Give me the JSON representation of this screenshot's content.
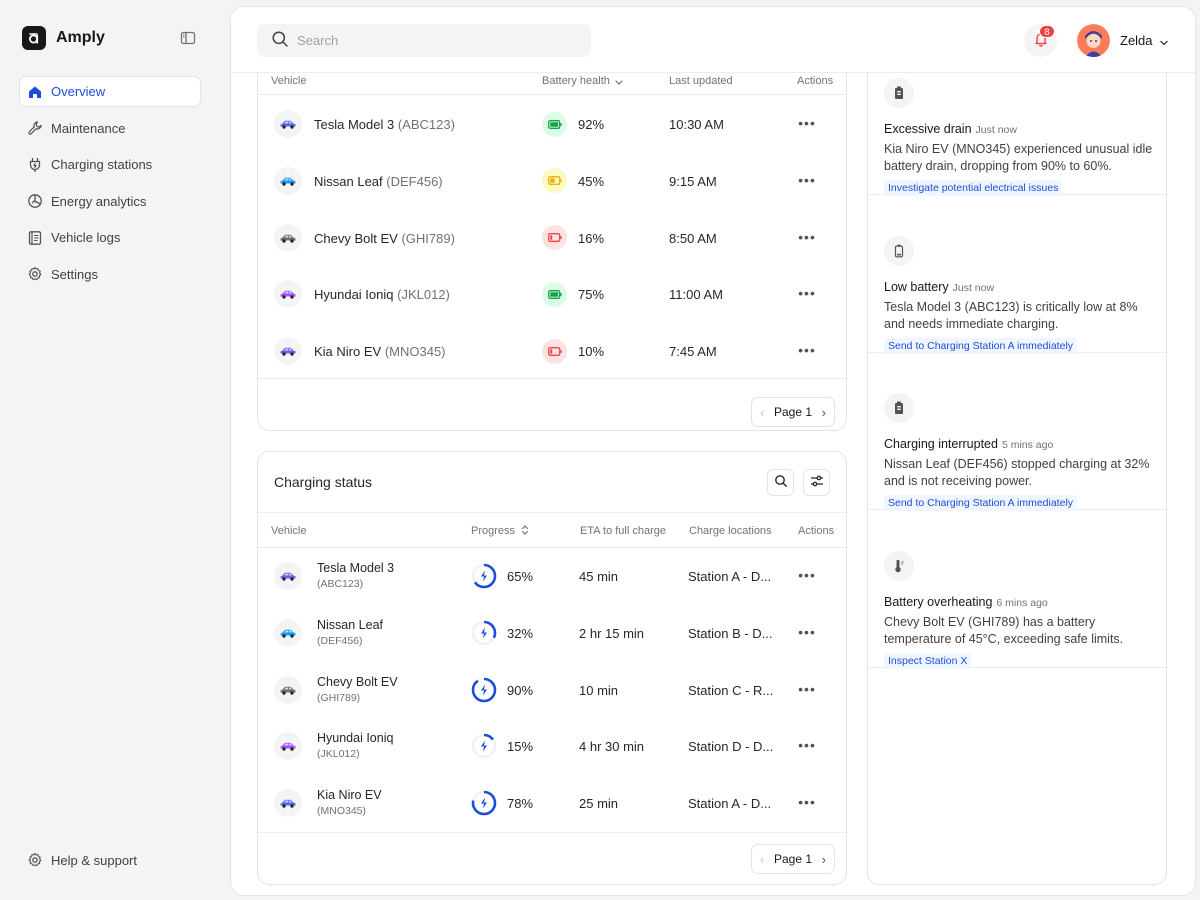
{
  "app": {
    "name": "Amply"
  },
  "sidebar": {
    "items": [
      {
        "label": "Overview",
        "icon": "home-icon",
        "active": true
      },
      {
        "label": "Maintenance",
        "icon": "wrench-icon",
        "active": false
      },
      {
        "label": "Charging stations",
        "icon": "plug-icon",
        "active": false
      },
      {
        "label": "Energy analytics",
        "icon": "chart-icon",
        "active": false
      },
      {
        "label": "Vehicle logs",
        "icon": "log-icon",
        "active": false
      },
      {
        "label": "Settings",
        "icon": "gear-icon",
        "active": false
      }
    ],
    "help_label": "Help & support"
  },
  "header": {
    "search_placeholder": "Search",
    "notification_count": "8",
    "user_name": "Zelda"
  },
  "health_table": {
    "columns": {
      "vehicle": "Vehicle",
      "battery": "Battery health",
      "updated": "Last updated",
      "actions": "Actions"
    },
    "rows": [
      {
        "name": "Tesla Model 3",
        "code": "(ABC123)",
        "battery": "92%",
        "level": "high",
        "updated": "10:30 AM",
        "car_color": "#6366f1"
      },
      {
        "name": "Nissan Leaf",
        "code": "(DEF456)",
        "battery": "45%",
        "level": "mid",
        "updated": "9:15 AM",
        "car_color": "#0ea5e9"
      },
      {
        "name": "Chevy Bolt EV",
        "code": "(GHI789)",
        "battery": "16%",
        "level": "low",
        "updated": "8:50 AM",
        "car_color": "#71717a"
      },
      {
        "name": "Hyundai Ioniq",
        "code": "(JKL012)",
        "battery": "75%",
        "level": "high",
        "updated": "11:00 AM",
        "car_color": "#a855f7"
      },
      {
        "name": "Kia Niro EV",
        "code": "(MNO345)",
        "battery": "10%",
        "level": "low",
        "updated": "7:45 AM",
        "car_color": "#6366f1"
      }
    ],
    "page_label": "Page 1"
  },
  "charging": {
    "title": "Charging status",
    "columns": {
      "vehicle": "Vehicle",
      "progress": "Progress",
      "eta": "ETA to full charge",
      "locations": "Charge locations",
      "actions": "Actions"
    },
    "rows": [
      {
        "name": "Tesla Model 3",
        "code": "(ABC123)",
        "progress": "65%",
        "fraction": 0.65,
        "eta": "45 min",
        "location": "Station A - D...",
        "car_color": "#6366f1"
      },
      {
        "name": "Nissan Leaf",
        "code": "(DEF456)",
        "progress": "32%",
        "fraction": 0.32,
        "eta": "2 hr 15 min",
        "location": "Station B - D...",
        "car_color": "#0ea5e9"
      },
      {
        "name": "Chevy Bolt EV",
        "code": "(GHI789)",
        "progress": "90%",
        "fraction": 0.9,
        "eta": "10 min",
        "location": "Station C - R...",
        "car_color": "#71717a"
      },
      {
        "name": "Hyundai Ioniq",
        "code": "(JKL012)",
        "progress": "15%",
        "fraction": 0.15,
        "eta": "4 hr 30 min",
        "location": "Station D - D...",
        "car_color": "#a855f7"
      },
      {
        "name": "Kia Niro EV",
        "code": "(MNO345)",
        "progress": "78%",
        "fraction": 0.78,
        "eta": "25 min",
        "location": "Station A - D...",
        "car_color": "#6366f1"
      }
    ],
    "page_label": "Page 1"
  },
  "alerts": [
    {
      "title": "Excessive drain",
      "time": "Just now",
      "body": "Kia Niro EV (MNO345) experienced unusual idle battery drain, dropping from 90% to 60%.",
      "action": "Investigate potential electrical issues",
      "icon": "battery-icon"
    },
    {
      "title": "Low battery",
      "time": "Just now",
      "body": "Tesla Model 3 (ABC123) is critically low at 8% and needs immediate charging.",
      "action": "Send to Charging Station A immediately",
      "icon": "battery-low-icon"
    },
    {
      "title": "Charging interrupted",
      "time": "5 mins ago",
      "body": "Nissan Leaf (DEF456) stopped charging at 32% and is not receiving power.",
      "action": "Send to Charging Station A immediately",
      "icon": "battery-icon"
    },
    {
      "title": "Battery overheating",
      "time": "6 mins ago",
      "body": "Chevy Bolt EV (GHI789) has a battery temperature of 45°C, exceeding safe limits.",
      "action": "Inspect Station X",
      "icon": "thermometer-icon"
    }
  ],
  "colors": {
    "accent": "#1d4ed8",
    "battery_high": "#16a34a",
    "battery_mid": "#eab308",
    "battery_low": "#ef4444",
    "badge": "#ef4444"
  }
}
